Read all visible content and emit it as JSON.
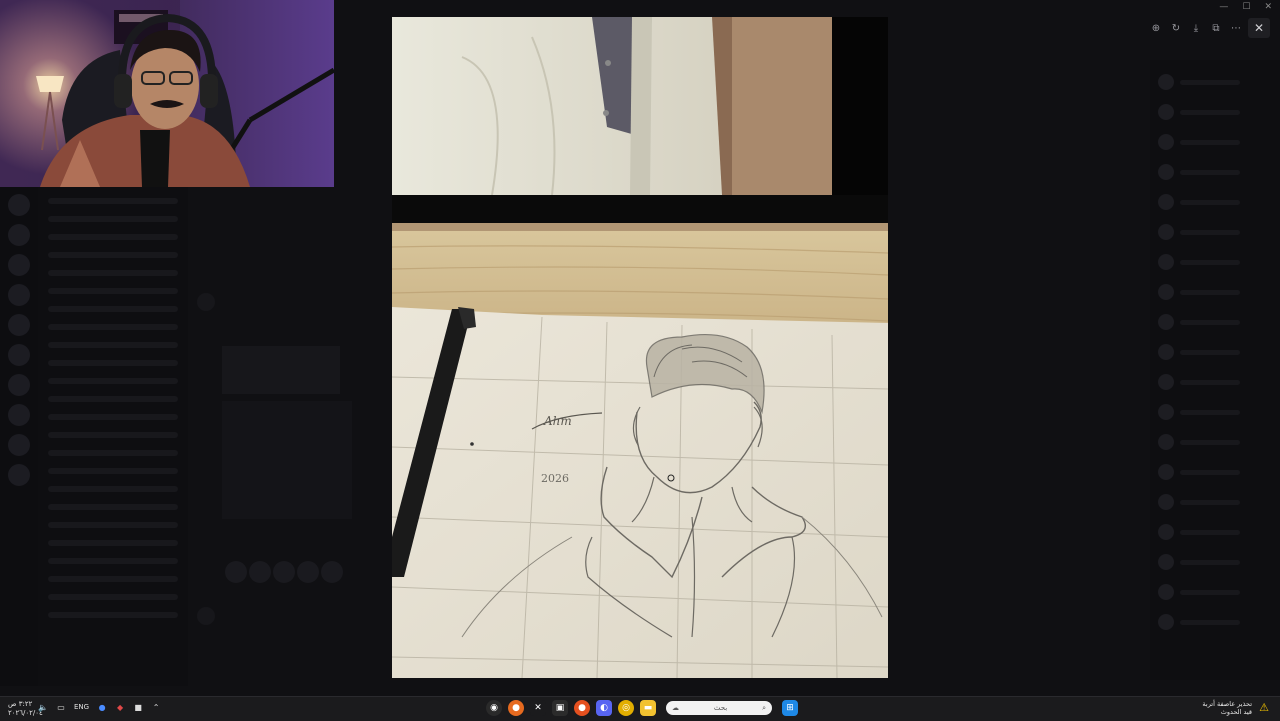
{
  "viewer": {
    "toolbar_icons": [
      "zoom-in-icon",
      "rotate-icon",
      "download-icon",
      "open-external-icon",
      "more-icon"
    ],
    "close_glyph": "✕"
  },
  "sketch": {
    "signature": "Ahm",
    "year": "2026"
  },
  "taskbar": {
    "time": "٣:٢٢ ص",
    "date": "٢٠٢٦/٠٢/٠٤",
    "language": "ENG",
    "search_placeholder": "بحث",
    "notification_title": "تحذير عاصفة أتربة",
    "notification_subtitle": "قيد الحدوث"
  },
  "colors": {
    "taskbar": "#1b1b1d",
    "warning": "#f5c400",
    "background": "#0b0b0d"
  }
}
